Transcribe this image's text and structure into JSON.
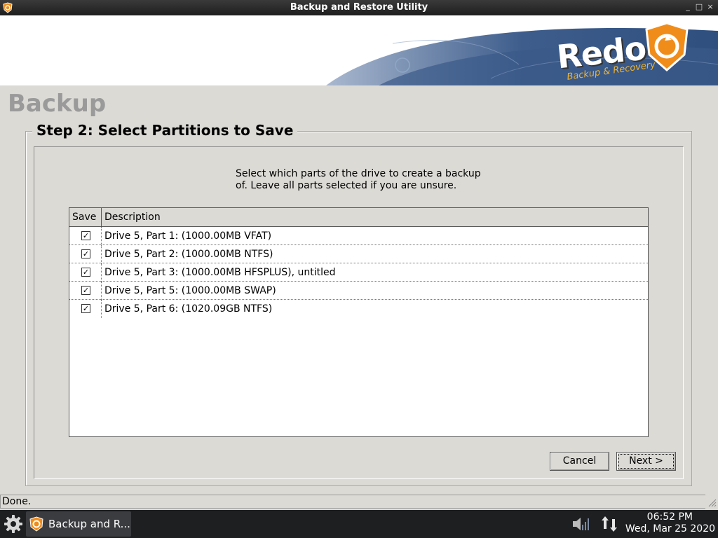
{
  "window": {
    "title": "Backup and Restore Utility",
    "minimize": "_",
    "maximize": "□",
    "close": "×"
  },
  "banner": {
    "logo_text": "Redo",
    "logo_tagline": "Backup & Recovery",
    "trademark": "™"
  },
  "page": {
    "heading": "Backup"
  },
  "step": {
    "legend": "Step 2: Select Partitions to Save",
    "instructions_line1": "Select which parts of the drive to create a backup",
    "instructions_line2": "of.  Leave all parts selected if you are unsure."
  },
  "table": {
    "headers": {
      "save": "Save",
      "description": "Description"
    },
    "rows": [
      {
        "checked": true,
        "check": "✓",
        "description": "Drive 5, Part 1: (1000.00MB VFAT)"
      },
      {
        "checked": true,
        "check": "✓",
        "description": "Drive 5, Part 2: (1000.00MB NTFS)"
      },
      {
        "checked": true,
        "check": "✓",
        "description": "Drive 5, Part 3: (1000.00MB HFSPLUS), untitled"
      },
      {
        "checked": true,
        "check": "✓",
        "description": "Drive 5, Part 5: (1000.00MB SWAP)"
      },
      {
        "checked": true,
        "check": "✓",
        "description": "Drive 5, Part 6: (1020.09GB NTFS)"
      }
    ]
  },
  "buttons": {
    "cancel": "Cancel",
    "next": "Next >"
  },
  "statusbar": {
    "text": "Done."
  },
  "taskbar": {
    "task_label": "Backup and R...",
    "clock_time": "06:52 PM",
    "clock_date": "Wed, Mar 25 2020"
  },
  "colors": {
    "logo_orange": "#f08c1a",
    "banner_blue": "#2f4f7f",
    "desktop_gray": "#dcdad5",
    "taskbar_dark": "#1d1f21"
  }
}
